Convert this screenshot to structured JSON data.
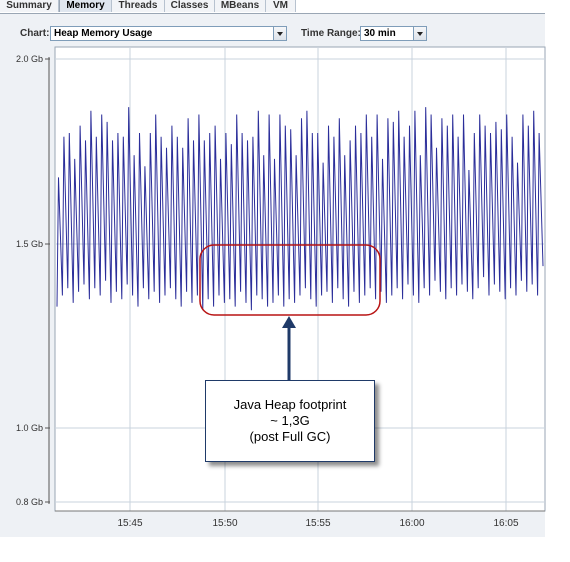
{
  "tabs": [
    {
      "label": "Summary",
      "active": false
    },
    {
      "label": "Memory",
      "active": true
    },
    {
      "label": "Threads",
      "active": false
    },
    {
      "label": "Classes",
      "active": false
    },
    {
      "label": "MBeans",
      "active": false
    },
    {
      "label": "VM",
      "active": false
    }
  ],
  "controls": {
    "chart_label": "Chart:",
    "chart_value": "Heap Memory Usage",
    "time_range_label": "Time Range:",
    "time_range_value": "30 min"
  },
  "annotation": {
    "line1": "Java Heap footprint",
    "line2": "~ 1,3G",
    "line3": "(post Full GC)"
  },
  "colors": {
    "series": "#2b2e9a",
    "highlight": "#b81414",
    "arrow": "#1f3a68",
    "grid": "#c9d3de"
  },
  "chart_data": {
    "type": "line",
    "yticks": [
      {
        "label": "2.0 Gb",
        "value": 2.0
      },
      {
        "label": "1.5 Gb",
        "value": 1.5
      },
      {
        "label": "1.0 Gb",
        "value": 1.0
      },
      {
        "label": "0.8 Gb",
        "value": 0.8
      }
    ],
    "xticks": [
      "15:45",
      "15:50",
      "15:55",
      "16:00",
      "16:05"
    ],
    "ylim": [
      0.8,
      2.0
    ],
    "grid": true,
    "series": [
      {
        "peaks": [
          1.68,
          1.79,
          1.8,
          1.73,
          1.82,
          1.78,
          1.86,
          1.79,
          1.85,
          1.83,
          1.78,
          1.8,
          1.79,
          1.87,
          1.74,
          1.8,
          1.71,
          1.8,
          1.85,
          1.79,
          1.76,
          1.82,
          1.79,
          1.76,
          1.84,
          1.78,
          1.85,
          1.78,
          1.8,
          1.82,
          1.73,
          1.8,
          1.77,
          1.85,
          1.8,
          1.78,
          1.79,
          1.86,
          1.74,
          1.85,
          1.73,
          1.85,
          1.82,
          1.81,
          1.74,
          1.84,
          1.86,
          1.8,
          1.8,
          1.72,
          1.82,
          1.79,
          1.84,
          1.74,
          1.78,
          1.82,
          1.8,
          1.85,
          1.79,
          1.85,
          1.73,
          1.84,
          1.83,
          1.86,
          1.79,
          1.82,
          1.86,
          1.74,
          1.87,
          1.85,
          1.76,
          1.84,
          1.82,
          1.85,
          1.79,
          1.85,
          1.7,
          1.8,
          1.85,
          1.82,
          1.8,
          1.83,
          1.81,
          1.85,
          1.79,
          1.72,
          1.85,
          1.82,
          1.86,
          1.8
        ],
        "troughs": [
          1.33,
          1.36,
          1.38,
          1.34,
          1.37,
          1.39,
          1.35,
          1.38,
          1.36,
          1.4,
          1.34,
          1.37,
          1.35,
          1.39,
          1.36,
          1.33,
          1.38,
          1.35,
          1.37,
          1.34,
          1.36,
          1.38,
          1.35,
          1.33,
          1.37,
          1.34,
          1.36,
          1.32,
          1.35,
          1.33,
          1.36,
          1.34,
          1.35,
          1.33,
          1.37,
          1.34,
          1.32,
          1.36,
          1.35,
          1.33,
          1.34,
          1.36,
          1.33,
          1.35,
          1.34,
          1.36,
          1.38,
          1.35,
          1.33,
          1.36,
          1.37,
          1.34,
          1.38,
          1.35,
          1.33,
          1.37,
          1.34,
          1.36,
          1.38,
          1.35,
          1.37,
          1.34,
          1.36,
          1.38,
          1.35,
          1.39,
          1.36,
          1.34,
          1.38,
          1.36,
          1.4,
          1.37,
          1.35,
          1.38,
          1.36,
          1.39,
          1.37,
          1.35,
          1.38,
          1.41,
          1.36,
          1.39,
          1.37,
          1.35,
          1.38,
          1.36,
          1.4,
          1.37,
          1.39,
          1.36
        ]
      }
    ]
  }
}
